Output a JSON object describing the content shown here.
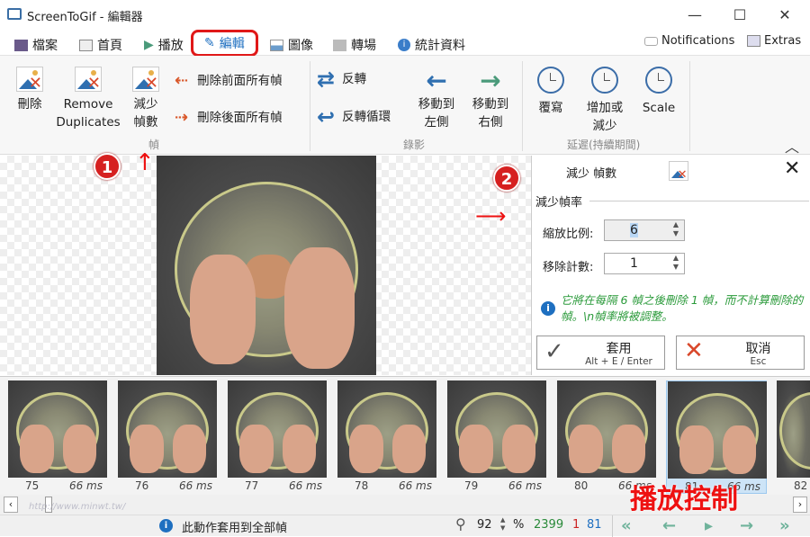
{
  "window": {
    "title": "ScreenToGif - 編輯器",
    "minimize": "—",
    "maximize": "☐",
    "close": "✕"
  },
  "tabs": [
    {
      "label": "檔案",
      "icon": "save-icon"
    },
    {
      "label": "首頁",
      "icon": "home-icon"
    },
    {
      "label": "播放",
      "icon": "play-icon"
    },
    {
      "label": "編輯",
      "icon": "pencil-icon",
      "active": true
    },
    {
      "label": "圖像",
      "icon": "image-icon"
    },
    {
      "label": "轉場",
      "icon": "transition-icon"
    },
    {
      "label": "統計資料",
      "icon": "info-icon"
    }
  ],
  "header_right": {
    "notifications": "Notifications",
    "extras": "Extras"
  },
  "ribbon": {
    "frames_group": {
      "label": "幀",
      "delete": "刪除",
      "remove_duplicates": "Remove Duplicates",
      "reduce_frames": "減少幀數",
      "delete_previous": "刪除前面所有幀",
      "delete_next": "刪除後面所有幀"
    },
    "record_group": {
      "label": "錄影",
      "reverse": "反轉",
      "yoyo": "反轉循環",
      "move_left": "移動到左側",
      "move_right": "移動到右側"
    },
    "delay_group": {
      "label": "延遲(持續期間)",
      "override": "覆寫",
      "increase_decrease": "增加或減少",
      "scale": "Scale"
    }
  },
  "panel": {
    "title": "減少 幀數",
    "section": "減少幀率",
    "factor_label": "縮放比例:",
    "factor_value": "6",
    "remove_label": "移除計數:",
    "remove_value": "1",
    "info": "它將在每隔 6 幀之後刪除 1 幀，而不計算刪除的幀。\\n幀率將被調整。",
    "apply": "套用",
    "apply_shortcut": "Alt + E / Enter",
    "cancel": "取消",
    "cancel_shortcut": "Esc"
  },
  "frames": [
    {
      "num": "75",
      "delay": "66 ms"
    },
    {
      "num": "76",
      "delay": "66 ms"
    },
    {
      "num": "77",
      "delay": "66 ms"
    },
    {
      "num": "78",
      "delay": "66 ms"
    },
    {
      "num": "79",
      "delay": "66 ms"
    },
    {
      "num": "80",
      "delay": "66 ms"
    },
    {
      "num": "81",
      "delay": "66 ms",
      "selected": true
    },
    {
      "num": "82",
      "delay": ""
    }
  ],
  "annotations": {
    "one": "1",
    "two": "2",
    "playback": "播放控制",
    "watermark": "http://www.minwt.tw/"
  },
  "status": {
    "message": "此動作套用到全部幀",
    "zoom": "92",
    "zoom_unit": "%",
    "total": "2399",
    "selected_count": "1",
    "current": "81"
  },
  "colors": {
    "accent": "#1e6fc0",
    "annotation": "#e11",
    "green": "#2a8a3a"
  }
}
